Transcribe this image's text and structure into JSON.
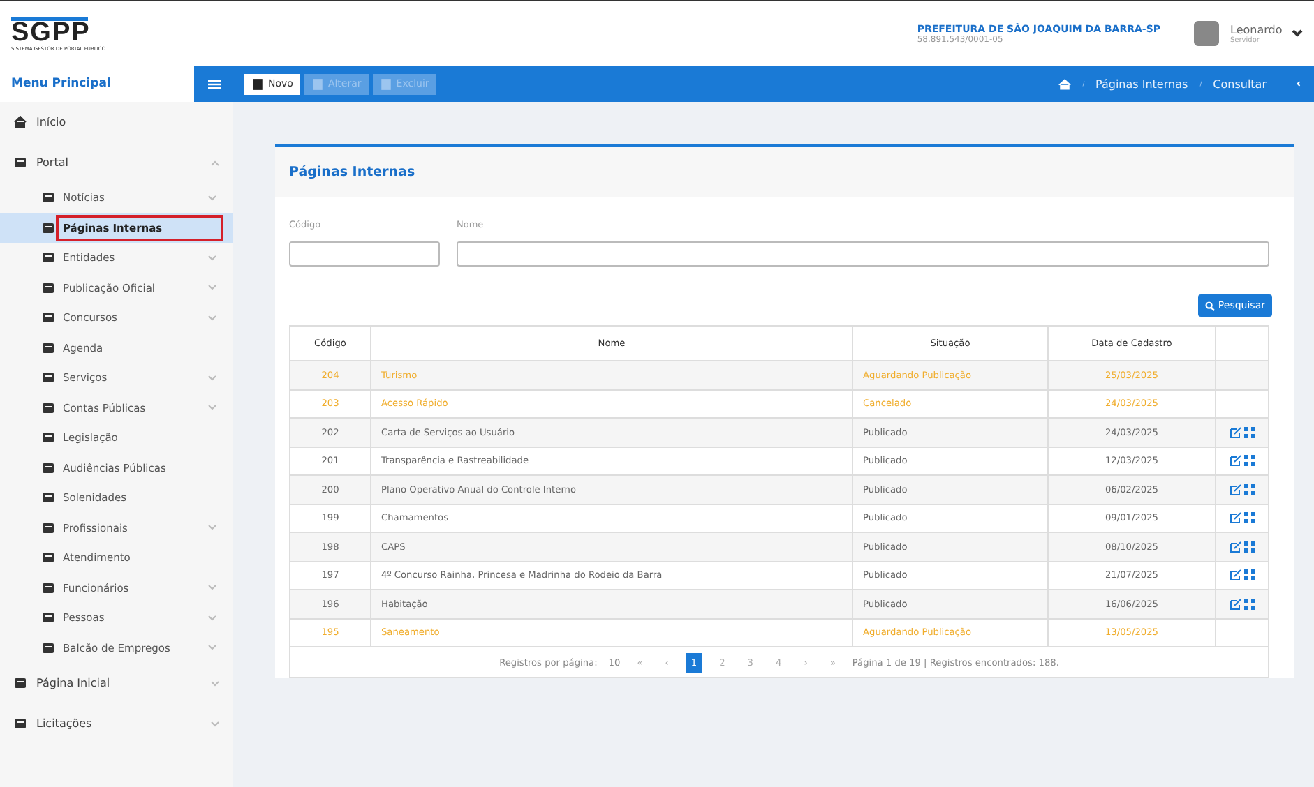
{
  "header": {
    "logo_text": "SGPP",
    "logo_subtitle": "SISTEMA GESTOR DE PORTAL PÚBLICO",
    "org_name": "PREFEITURA DE SÃO JOAQUIM DA BARRA-SP",
    "org_id": "58.891.543/0001-05",
    "user_name": "Leonardo",
    "user_role": "Servidor"
  },
  "sidebar": {
    "title": "Menu Principal",
    "items": [
      {
        "label": "Início",
        "expandable": false
      },
      {
        "label": "Portal",
        "expandable": true,
        "expanded": true,
        "children": [
          {
            "label": "Notícias",
            "expandable": true,
            "selected": false
          },
          {
            "label": "Páginas Internas",
            "expandable": false,
            "selected": true
          },
          {
            "label": "Entidades",
            "expandable": true,
            "selected": false
          },
          {
            "label": "Publicação Oficial",
            "expandable": true,
            "selected": false
          },
          {
            "label": "Concursos",
            "expandable": true,
            "selected": false
          },
          {
            "label": "Agenda",
            "expandable": false,
            "selected": false
          },
          {
            "label": "Serviços",
            "expandable": true,
            "selected": false
          },
          {
            "label": "Contas Públicas",
            "expandable": true,
            "selected": false
          },
          {
            "label": "Legislação",
            "expandable": false,
            "selected": false
          },
          {
            "label": "Audiências Públicas",
            "expandable": false,
            "selected": false
          },
          {
            "label": "Solenidades",
            "expandable": false,
            "selected": false
          },
          {
            "label": "Profissionais",
            "expandable": true,
            "selected": false
          },
          {
            "label": "Atendimento",
            "expandable": false,
            "selected": false
          },
          {
            "label": "Funcionários",
            "expandable": true,
            "selected": false
          },
          {
            "label": "Pessoas",
            "expandable": true,
            "selected": false
          },
          {
            "label": "Balcão de Empregos",
            "expandable": true,
            "selected": false
          }
        ]
      },
      {
        "label": "Página Inicial",
        "expandable": true,
        "expanded": false
      },
      {
        "label": "Licitações",
        "expandable": true,
        "expanded": false
      }
    ]
  },
  "toolbar": {
    "buttons": [
      {
        "label": "Novo",
        "disabled": false
      },
      {
        "label": "Alterar",
        "disabled": true
      },
      {
        "label": "Excluir",
        "disabled": true
      }
    ],
    "breadcrumb": [
      "Páginas Internas",
      "Consultar"
    ]
  },
  "panel": {
    "title": "Páginas Internas",
    "fields": [
      {
        "label": "Código"
      },
      {
        "label": "Nome"
      }
    ],
    "search_button": "Pesquisar",
    "table": {
      "columns": [
        "Código",
        "Nome",
        "Situação",
        "Data de Cadastro"
      ],
      "rows": [
        {
          "code": "204",
          "name": "Turismo",
          "status": "Aguardando Publicação",
          "date": "25/03/2025",
          "kind": "pending",
          "actions": false
        },
        {
          "code": "203",
          "name": "Acesso Rápido",
          "status": "Cancelado",
          "date": "24/03/2025",
          "kind": "pending",
          "actions": false
        },
        {
          "code": "202",
          "name": "Carta de Serviços ao Usuário",
          "status": "Publicado",
          "date": "24/03/2025",
          "kind": "published",
          "actions": true
        },
        {
          "code": "201",
          "name": "Transparência e Rastreabilidade",
          "status": "Publicado",
          "date": "12/03/2025",
          "kind": "published",
          "actions": true
        },
        {
          "code": "200",
          "name": "Plano Operativo Anual do Controle Interno",
          "status": "Publicado",
          "date": "06/02/2025",
          "kind": "published",
          "actions": true
        },
        {
          "code": "199",
          "name": "Chamamentos",
          "status": "Publicado",
          "date": "09/01/2025",
          "kind": "published",
          "actions": true
        },
        {
          "code": "198",
          "name": "CAPS",
          "status": "Publicado",
          "date": "08/10/2025",
          "kind": "published",
          "actions": true
        },
        {
          "code": "197",
          "name": "4º Concurso Rainha, Princesa e Madrinha do Rodeio da Barra",
          "status": "Publicado",
          "date": "21/07/2025",
          "kind": "published",
          "actions": true
        },
        {
          "code": "196",
          "name": "Habitação",
          "status": "Publicado",
          "date": "16/06/2025",
          "kind": "published",
          "actions": true
        },
        {
          "code": "195",
          "name": "Saneamento",
          "status": "Aguardando Publicação",
          "date": "13/05/2025",
          "kind": "pending",
          "actions": false
        }
      ]
    },
    "pager": {
      "per_page_label": "Registros por página:",
      "per_page": "10",
      "first": "«",
      "prev": "‹",
      "pages": [
        {
          "label": "1",
          "selected": true
        },
        {
          "label": "2",
          "selected": false
        },
        {
          "label": "3",
          "selected": false
        },
        {
          "label": "4",
          "selected": false
        }
      ],
      "next": "›",
      "last": "»",
      "summary": "Página 1 de 19 | Registros encontrados: 188."
    }
  }
}
